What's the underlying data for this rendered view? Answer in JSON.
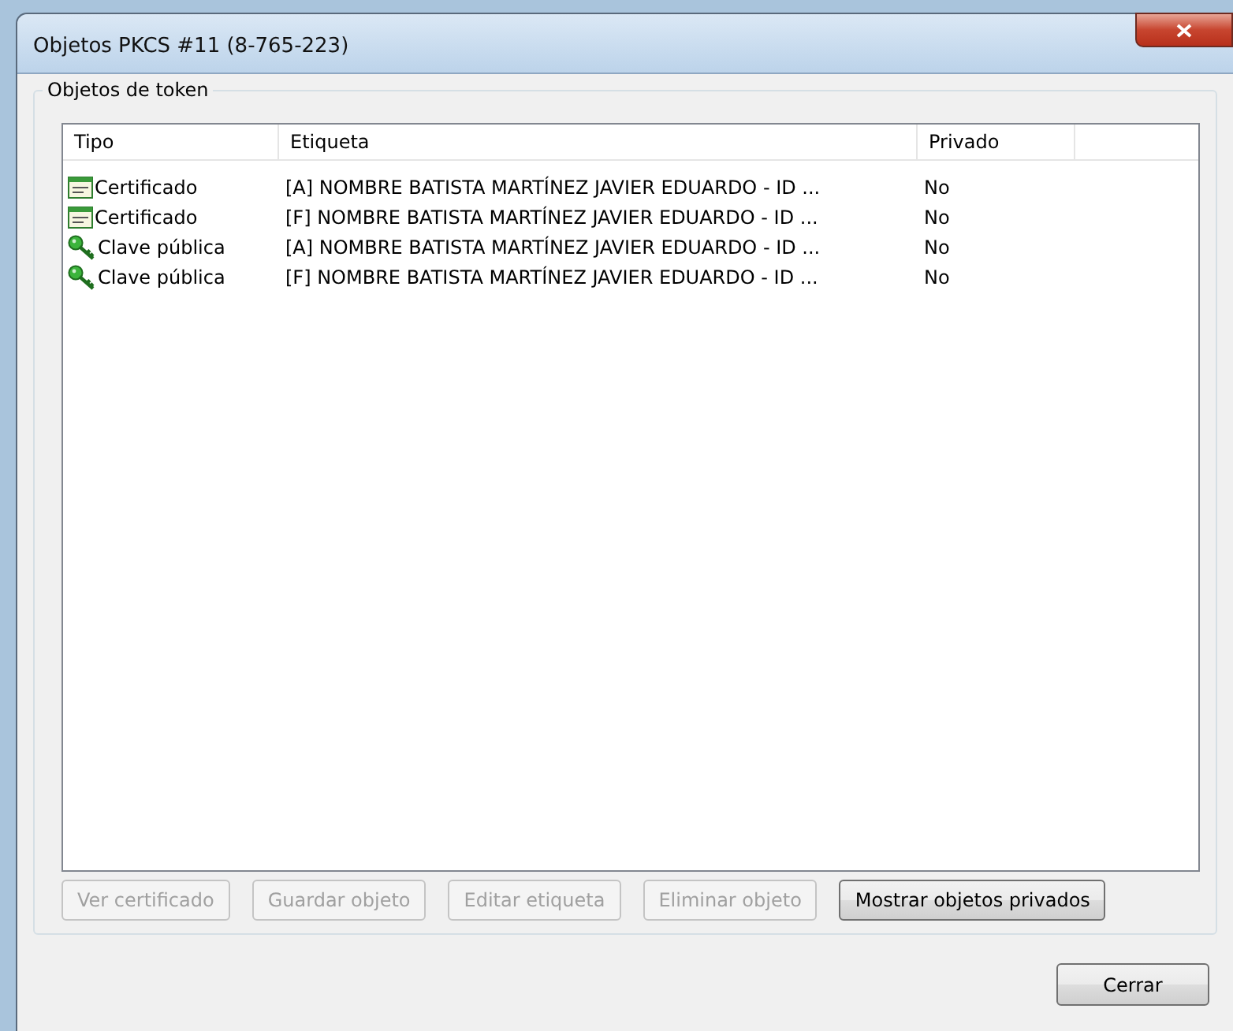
{
  "window": {
    "title": "Objetos PKCS #11 (8-765-223)"
  },
  "group": {
    "title": "Objetos de token"
  },
  "table": {
    "columns": [
      "Tipo",
      "Etiqueta",
      "Privado"
    ],
    "rows": [
      {
        "kind": "certificate",
        "type": "Certificado",
        "label": "[A] NOMBRE BATISTA MARTÍNEZ JAVIER EDUARDO - ID ...",
        "private": "No"
      },
      {
        "kind": "certificate",
        "type": "Certificado",
        "label": "[F] NOMBRE BATISTA MARTÍNEZ JAVIER EDUARDO - ID ...",
        "private": "No"
      },
      {
        "kind": "key",
        "type": "Clave pública",
        "label": "[A] NOMBRE BATISTA MARTÍNEZ JAVIER EDUARDO - ID ...",
        "private": "No"
      },
      {
        "kind": "key",
        "type": "Clave pública",
        "label": "[F] NOMBRE BATISTA MARTÍNEZ JAVIER EDUARDO - ID ...",
        "private": "No"
      }
    ]
  },
  "buttons": [
    {
      "label": "Ver certificado",
      "disabled": true
    },
    {
      "label": "Guardar objeto",
      "disabled": true
    },
    {
      "label": "Editar etiqueta",
      "disabled": true
    },
    {
      "label": "Eliminar objeto",
      "disabled": true
    },
    {
      "label": "Mostrar objetos privados",
      "disabled": false
    }
  ],
  "close_button": "Cerrar"
}
